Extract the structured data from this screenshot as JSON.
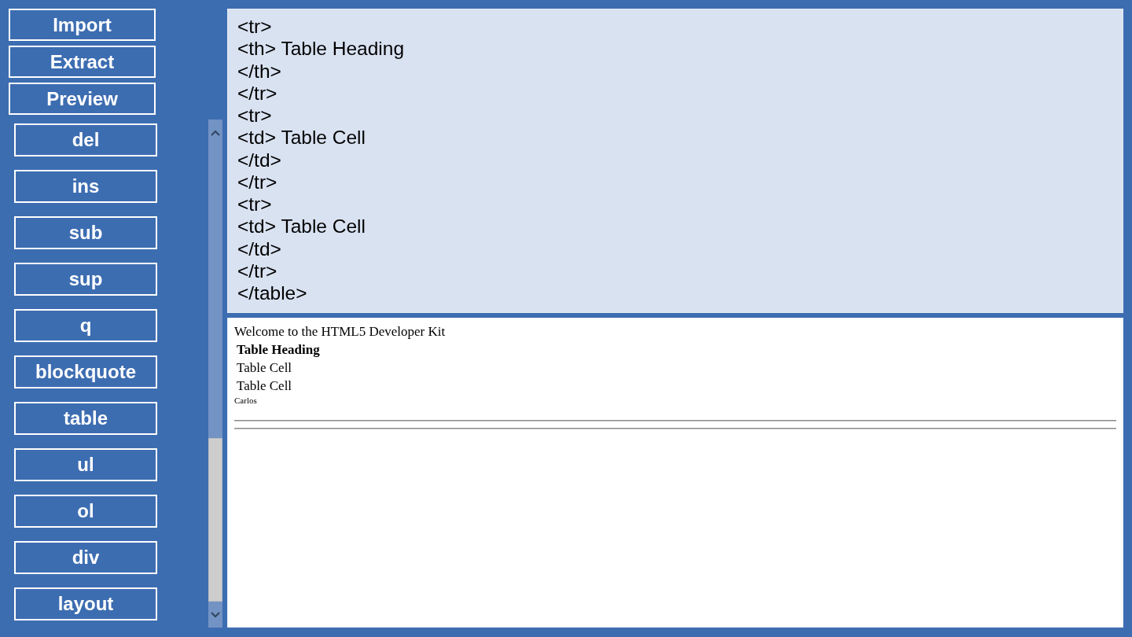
{
  "toolbar": {
    "buttons": [
      "Import",
      "Extract",
      "Preview"
    ]
  },
  "tag_buttons": [
    "del",
    "ins",
    "sub",
    "sup",
    "q",
    "blockquote",
    "table",
    "ul",
    "ol",
    "div",
    "layout"
  ],
  "editor": {
    "lines": [
      "<tr>",
      "<th> Table Heading",
      "</th>",
      "</tr>",
      "<tr>",
      "<td> Table Cell",
      "</td>",
      "</tr>",
      "<tr>",
      "<td> Table Cell",
      "</td>",
      "</tr>",
      "</table>"
    ]
  },
  "preview": {
    "blocks": [
      {
        "kind": "text",
        "text": "Welcome to the HTML5 Developer Kit"
      },
      {
        "kind": "table",
        "rows": [
          {
            "cells": [
              {
                "kind": "heading",
                "text": "Table Heading"
              }
            ]
          },
          {
            "cells": [
              {
                "kind": "cell",
                "text": "Table Cell"
              }
            ]
          },
          {
            "cells": [
              {
                "kind": "cell",
                "text": "Table Cell"
              }
            ]
          }
        ]
      },
      {
        "kind": "small",
        "text": "Carlos"
      },
      {
        "kind": "rule"
      },
      {
        "kind": "rule"
      }
    ]
  }
}
